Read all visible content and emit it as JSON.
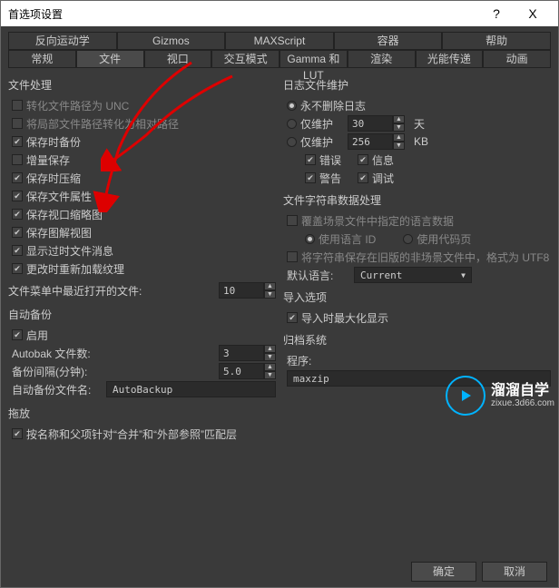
{
  "titlebar": {
    "title": "首选项设置",
    "help": "?",
    "close": "X"
  },
  "tabs_row1": [
    "反向运动学",
    "Gizmos",
    "MAXScript",
    "容器",
    "帮助"
  ],
  "tabs_row2": [
    "常规",
    "文件",
    "视口",
    "交互模式",
    "Gamma 和 LUT",
    "渲染",
    "光能传递",
    "动画"
  ],
  "active_tab_row2": 1,
  "file_handling": {
    "title": "文件处理",
    "convert_unc": "转化文件路径为 UNC",
    "convert_rel": "将局部文件路径转化为相对路径",
    "backup_save": "保存时备份",
    "incremental": "增量保存",
    "compress_save": "保存时压缩",
    "save_props": "保存文件属性",
    "save_thumb": "保存视口缩略图",
    "save_schematic": "保存图解视图",
    "show_obsolete": "显示过时文件消息",
    "reload_tex": "更改时重新加载纹理",
    "recent_label": "文件菜单中最近打开的文件:",
    "recent_value": "10"
  },
  "auto_backup": {
    "title": "自动备份",
    "enable": "启用",
    "count_label": "Autobak 文件数:",
    "count_value": "3",
    "interval_label": "备份间隔(分钟):",
    "interval_value": "5.0",
    "name_label": "自动备份文件名:",
    "name_value": "AutoBackup"
  },
  "log_maint": {
    "title": "日志文件维护",
    "never": "永不删除日志",
    "keep_days": "仅维护",
    "days_value": "30",
    "days_unit": "天",
    "keep_kb": "仅维护",
    "kb_value": "256",
    "kb_unit": "KB",
    "error": "错误",
    "info": "信息",
    "warn": "警告",
    "debug": "调试"
  },
  "string_handling": {
    "title": "文件字符串数据处理",
    "override": "覆盖场景文件中指定的语言数据",
    "use_lang_id": "使用语言 ID",
    "use_codepage": "使用代码页",
    "save_utf8": "将字符串保存在旧版的非场景文件中，格式为 UTF8",
    "default_lang_label": "默认语言:",
    "default_lang_value": "Current"
  },
  "import": {
    "title": "导入选项",
    "maximize": "导入时最大化显示"
  },
  "archive": {
    "title": "归档系统",
    "program_label": "程序:",
    "program_value": "maxzip"
  },
  "drag_drop": {
    "title": "拖放",
    "match": "按名称和父项针对“合并”和“外部参照”匹配层"
  },
  "footer": {
    "ok": "确定",
    "cancel": "取消"
  },
  "watermark": {
    "brand": "溜溜自学",
    "url": "zixue.3d66.com"
  }
}
